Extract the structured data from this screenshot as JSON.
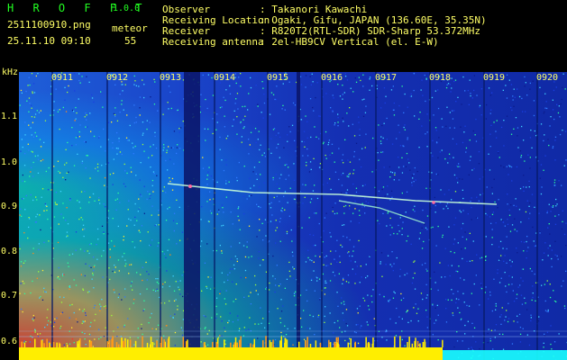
{
  "header": {
    "app_name": "H R O F F T",
    "version": "1.0.0",
    "filename": "2511100910.png",
    "timestamp": "25.11.10 09:10",
    "meteor_label": "meteor",
    "meteor_count": "55",
    "info": [
      {
        "label": "Observer",
        "value": ": Takanori Kawachi"
      },
      {
        "label": "Receiving Location",
        "value": ": Ogaki, Gifu, JAPAN (136.60E, 35.35N)"
      },
      {
        "label": "Receiver",
        "value": ": R820T2(RTL-SDR) SDR-Sharp 53.372MHz"
      },
      {
        "label": "Receiving antenna",
        "value": ": 2el-HB9CV Vertical (el. E-W)"
      }
    ]
  },
  "spectrogram": {
    "y_unit": "kHz",
    "time_ticks": [
      "0911",
      "0912",
      "0913",
      "0914",
      "0915",
      "0916",
      "0917",
      "0918",
      "0919",
      "0920"
    ],
    "freq_ticks": [
      "1.1",
      "1.0",
      "0.9",
      "0.8",
      "0.7",
      "0.6"
    ],
    "colors": {
      "background": "#000000",
      "label": "#ffff66",
      "title": "#22ff22",
      "noise_floor": "#ffee00"
    }
  }
}
